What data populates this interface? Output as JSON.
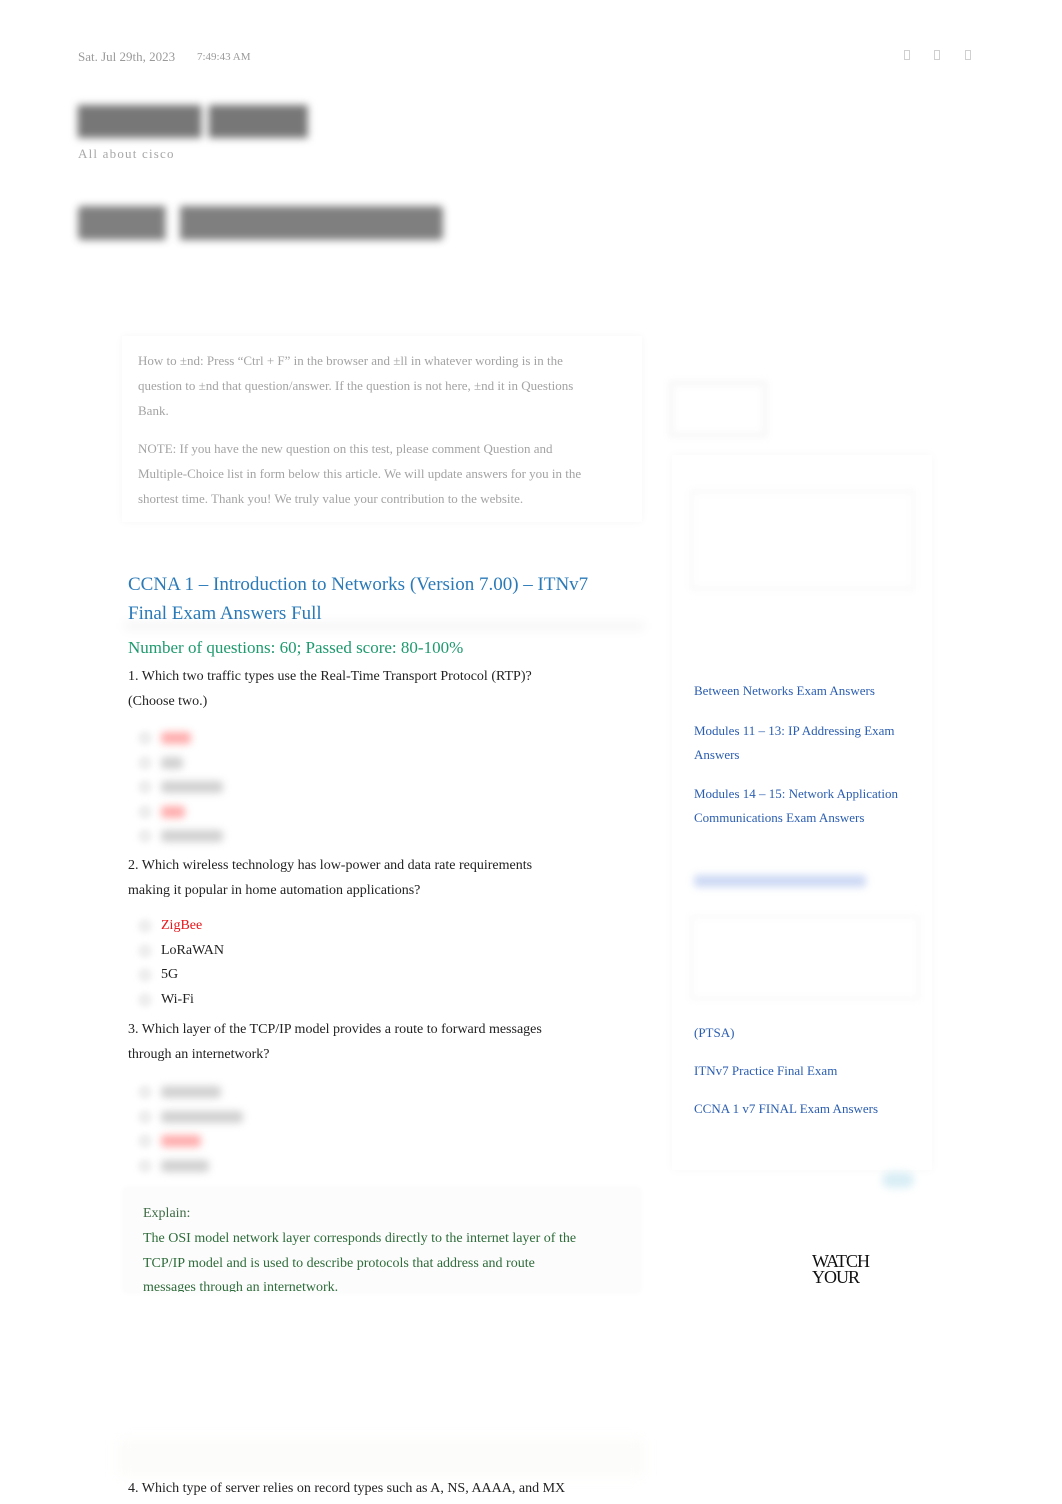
{
  "topbar": {
    "date": "Sat. Jul 29th, 2023",
    "time": "7:49:43 AM",
    "social_icons": [
      "social-icon-1",
      "social-icon-2",
      "social-icon-3"
    ]
  },
  "branding": {
    "tagline": "All about cisco"
  },
  "notice": {
    "how_to_find": "How to ±nd:  Press “Ctrl + F” in the browser and ±ll in whatever wording is in the question to ±nd that question/answer. If the question is not here, ±nd it in Questions Bank.",
    "note": "NOTE: If you have the new question on this test, please comment Question and Multiple-Choice list in form below this article. We will update answers for you in the shortest time. Thank you! We truly value your contribution to the website."
  },
  "article": {
    "title": "CCNA 1 – Introduction to Networks (Version 7.00) – ITNv7 Final Exam Answers Full",
    "meta": "Number of questions: 60; Passed score: 80-100%",
    "questions": [
      {
        "text": "1. Which two traffic types use the Real-Time Transport Protocol (RTP)? (Choose two.)",
        "choices": [
          {
            "text": "",
            "correct": true,
            "blurred": true
          },
          {
            "text": "",
            "correct": false,
            "blurred": true
          },
          {
            "text": "",
            "correct": false,
            "blurred": true
          },
          {
            "text": "",
            "correct": true,
            "blurred": true
          },
          {
            "text": "",
            "correct": false,
            "blurred": true
          }
        ]
      },
      {
        "text": "2. Which wireless technology has low-power and data rate requirements making it popular in home automation applications?",
        "choices": [
          {
            "text": "ZigBee",
            "correct": true,
            "blurred": false
          },
          {
            "text": "LoRaWAN",
            "correct": false,
            "blurred": false
          },
          {
            "text": "5G",
            "correct": false,
            "blurred": false
          },
          {
            "text": "Wi-Fi",
            "correct": false,
            "blurred": false
          }
        ]
      },
      {
        "text": "3. Which layer of the TCP/IP model provides a route to forward messages through an internetwork?",
        "choices": [
          {
            "text": "",
            "correct": false,
            "blurred": true
          },
          {
            "text": "",
            "correct": false,
            "blurred": true
          },
          {
            "text": "",
            "correct": true,
            "blurred": true
          },
          {
            "text": "",
            "correct": false,
            "blurred": true
          }
        ]
      },
      {
        "text": "4. Which type of server relies on record types such as A, NS, AAAA, and MX"
      }
    ],
    "explain": {
      "label": "Explain:",
      "body": "The OSI model network layer corresponds directly to the internet layer of the TCP/IP model and is used to describe protocols that address and route messages through an internetwork."
    }
  },
  "sidebar": {
    "links_group_1": [
      "Between Networks Exam Answers",
      "Modules 11 – 13: IP Addressing Exam Answers",
      "Modules 14 – 15: Network Application Communications Exam Answers"
    ],
    "links_group_2": [
      "(PTSA)",
      "ITNv7 Practice Final Exam",
      "CCNA 1 v7 FINAL Exam Answers"
    ],
    "ad_text": "WATCH YOUR"
  },
  "colors": {
    "link": "#2a5db0",
    "title": "#2a7ab8",
    "meta_green": "#1f9a6e",
    "correct_red": "#e8161b",
    "explain_green": "#2e6b3a"
  }
}
